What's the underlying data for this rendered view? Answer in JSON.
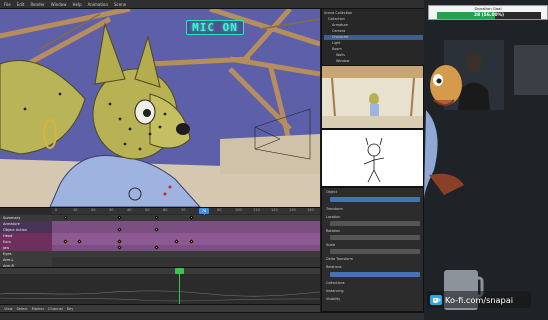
{
  "header": {
    "items": [
      "File",
      "Edit",
      "Render",
      "Window",
      "Help",
      "Animation",
      "Scene"
    ]
  },
  "overlay": {
    "mic_text": "MIC ON"
  },
  "timeline": {
    "channels": [
      "Summary",
      "Armature",
      "Object Action",
      "Head",
      "Ears",
      "Jaw",
      "Eyes",
      "Arm.L",
      "Arm.R"
    ],
    "frames": [
      "0",
      "10",
      "20",
      "30",
      "40",
      "50",
      "60",
      "70",
      "80",
      "90",
      "100",
      "110",
      "120",
      "130",
      "140"
    ],
    "current_frame": "76"
  },
  "graph": {
    "footer_items": [
      "View",
      "Select",
      "Marker",
      "Channel",
      "Key"
    ]
  },
  "outliner": {
    "rows": [
      "Scene Collection",
      "Collection",
      "Armature",
      "Camera",
      "Character",
      "Light",
      "Room",
      "Walls",
      "Window"
    ]
  },
  "properties": {
    "labels": [
      "Object",
      "Transform",
      "Location",
      "Rotation",
      "Scale",
      "Delta Transform",
      "Relations",
      "Collections",
      "Instancing",
      "Visibility"
    ]
  },
  "donation_goal": {
    "title": "Donation Goal",
    "progress_text": "28 (56.00%)",
    "fraction": 0.56
  },
  "kofi": {
    "text": "Ko-fi.com/snapai"
  },
  "status_bar": {
    "text": ""
  }
}
